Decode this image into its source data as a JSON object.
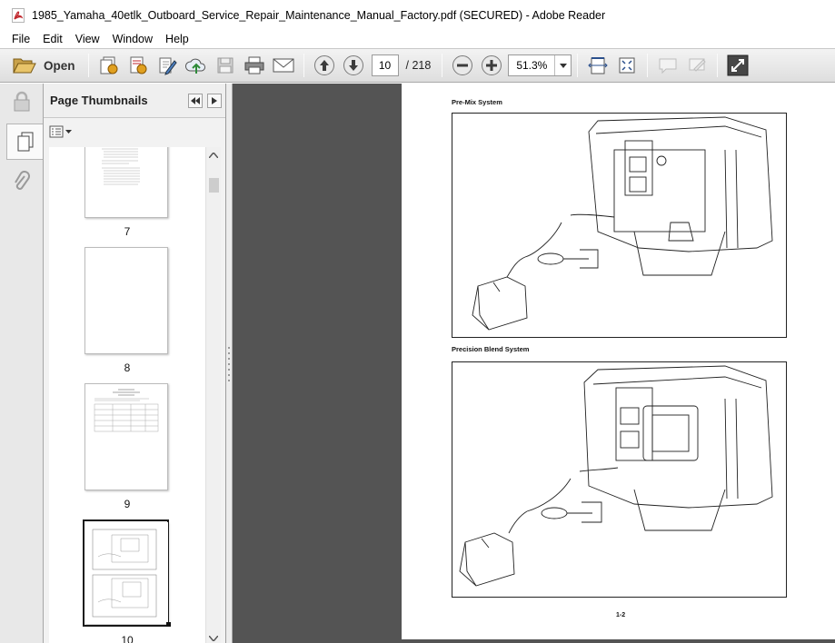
{
  "window": {
    "title": "1985_Yamaha_40etlk_Outboard_Service_Repair_Maintenance_Manual_Factory.pdf (SECURED) - Adobe Reader"
  },
  "menu": [
    "File",
    "Edit",
    "View",
    "Window",
    "Help"
  ],
  "toolbar": {
    "open_label": "Open",
    "current_page": "10",
    "total_pages": "/  218",
    "zoom": "51.3%"
  },
  "sidebar": {
    "panel_title": "Page Thumbnails",
    "thumbnails": [
      {
        "label": "7"
      },
      {
        "label": "8"
      },
      {
        "label": "9"
      },
      {
        "label": "10"
      }
    ],
    "selected": "10"
  },
  "document": {
    "caption_top": "Pre-Mix System",
    "caption_bottom": "Precision Blend System",
    "page_number": "1-2"
  },
  "colors": {
    "doc_background": "#545454",
    "toolbar": "#e4e4e4",
    "acrobat_red": "#c0272d"
  }
}
